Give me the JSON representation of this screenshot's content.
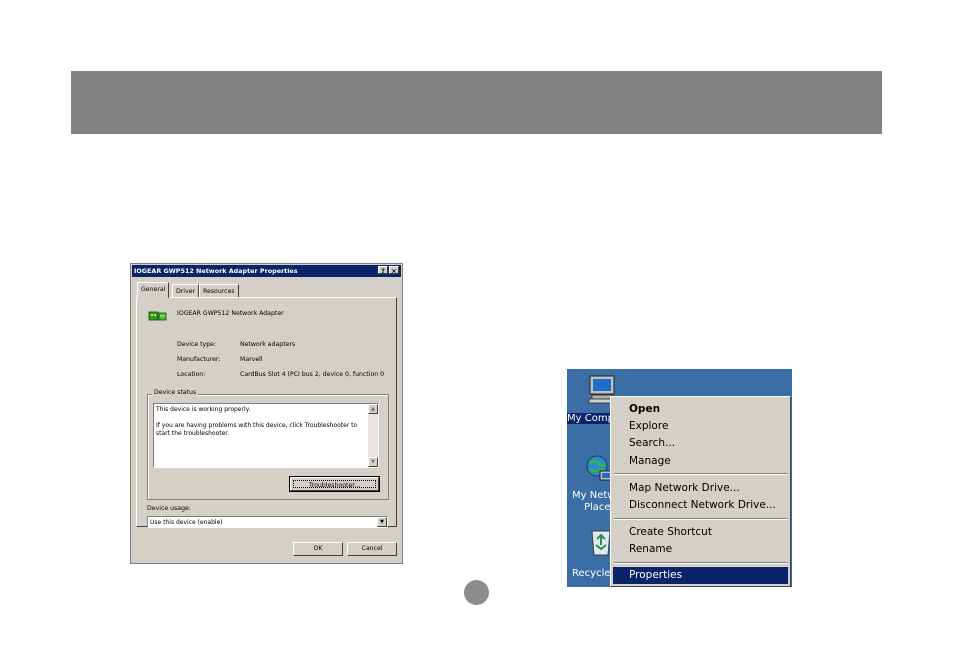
{
  "colors": {
    "band": "#808284",
    "dialog_face": "#d4d0c8",
    "titlebar": "#0a246a",
    "desktop": "#3a6ea5",
    "menu_highlight": "#0a246a"
  },
  "dialog": {
    "title": "IOGEAR GWP512 Network Adapter Properties",
    "help_btn": "?",
    "close_btn": "×",
    "tabs": [
      "General",
      "Driver",
      "Resources"
    ],
    "device_name": "IOGEAR GWP512 Network Adapter",
    "fields": [
      {
        "label": "Device type:",
        "value": "Network adapters"
      },
      {
        "label": "Manufacturer:",
        "value": "Marvell"
      },
      {
        "label": "Location:",
        "value": "CardBus Slot 4 (PCI bus 2, device 0, function 0"
      }
    ],
    "status_group": "Device status",
    "status_lines": [
      "This device is working properly.",
      "",
      "If you are having problems with this device, click Troubleshooter to",
      "start the troubleshooter."
    ],
    "troubleshooter_label": "Troubleshooter...",
    "usage_label": "Device usage:",
    "usage_value": "Use this device (enable)",
    "ok_label": "OK",
    "cancel_label": "Cancel"
  },
  "desktop": {
    "icons": [
      {
        "name": "my-computer",
        "label": "My Comp",
        "icon": "monitor-icon"
      },
      {
        "name": "my-network-places",
        "label_lines": [
          "My Netw",
          "Place"
        ],
        "icon": "network-globe-icon"
      },
      {
        "name": "recycle-bin",
        "label": "Recycle",
        "icon": "recycle-bin-icon"
      }
    ]
  },
  "context_menu": {
    "groups": [
      [
        "Open",
        "Explore",
        "Search...",
        "Manage"
      ],
      [
        "Map Network Drive...",
        "Disconnect Network Drive..."
      ],
      [
        "Create Shortcut",
        "Rename"
      ],
      [
        "Properties"
      ]
    ],
    "default_item": "Open",
    "highlighted_item": "Properties"
  }
}
